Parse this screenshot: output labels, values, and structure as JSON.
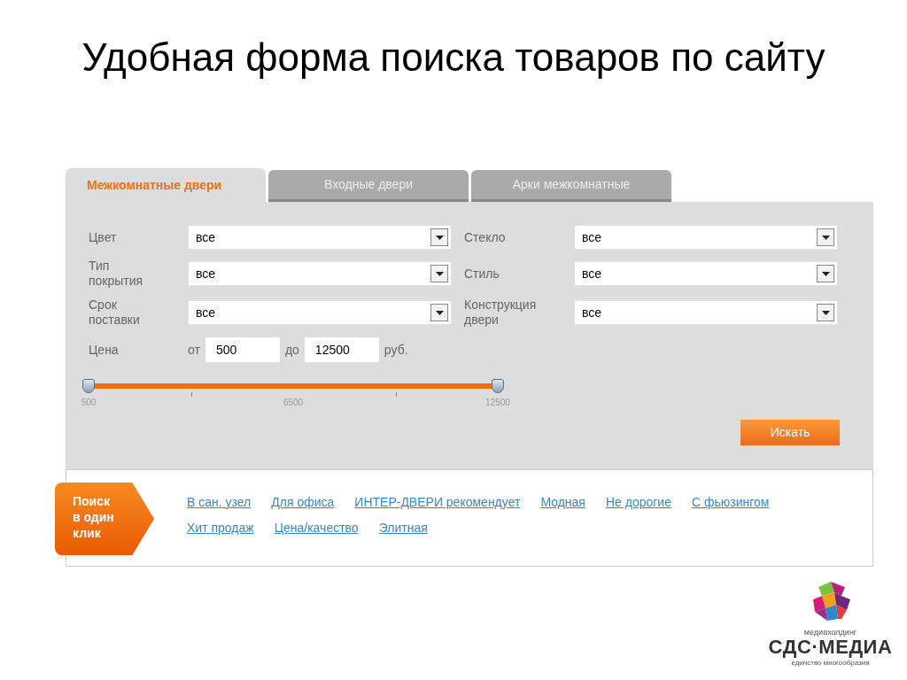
{
  "slide_title": "Удобная форма поиска товаров по сайту",
  "tabs": [
    {
      "label": "Межкомнатные двери",
      "selected": true
    },
    {
      "label": "Входные двери",
      "selected": false
    },
    {
      "label": "Арки межкомнатные",
      "selected": false
    }
  ],
  "filters": [
    {
      "label": "Цвет",
      "value": "все"
    },
    {
      "label": "Стекло",
      "value": "все"
    },
    {
      "label": "Тип покрытия",
      "value": "все"
    },
    {
      "label": "Стиль",
      "value": "все"
    },
    {
      "label": "Срок поставки",
      "value": "все"
    },
    {
      "label": "Конструкция двери",
      "value": "все"
    }
  ],
  "price": {
    "label": "Цена",
    "from_label": "от",
    "from_value": "500",
    "to_label": "до",
    "to_value": "12500",
    "unit": "руб."
  },
  "slider": {
    "thumbs": [
      {
        "level": 0
      },
      {
        "level": 1
      }
    ],
    "tick_labels": [
      "500",
      "6500",
      "12500"
    ]
  },
  "search_button": "Искать",
  "quick_search": {
    "badge": "Поиск в один клик",
    "links": [
      "В сан. узел",
      "Для офиса",
      "ИНТЕР-ДВЕРИ рекомендует",
      "Модная",
      "Не дорогие",
      "С фьюзингом",
      "Хит продаж",
      "Цена/качество",
      "Элитная"
    ]
  },
  "logo": {
    "caption": "медиахолдинг",
    "name": "СДС·МЕДИА",
    "tagline": "единство многообразия"
  }
}
